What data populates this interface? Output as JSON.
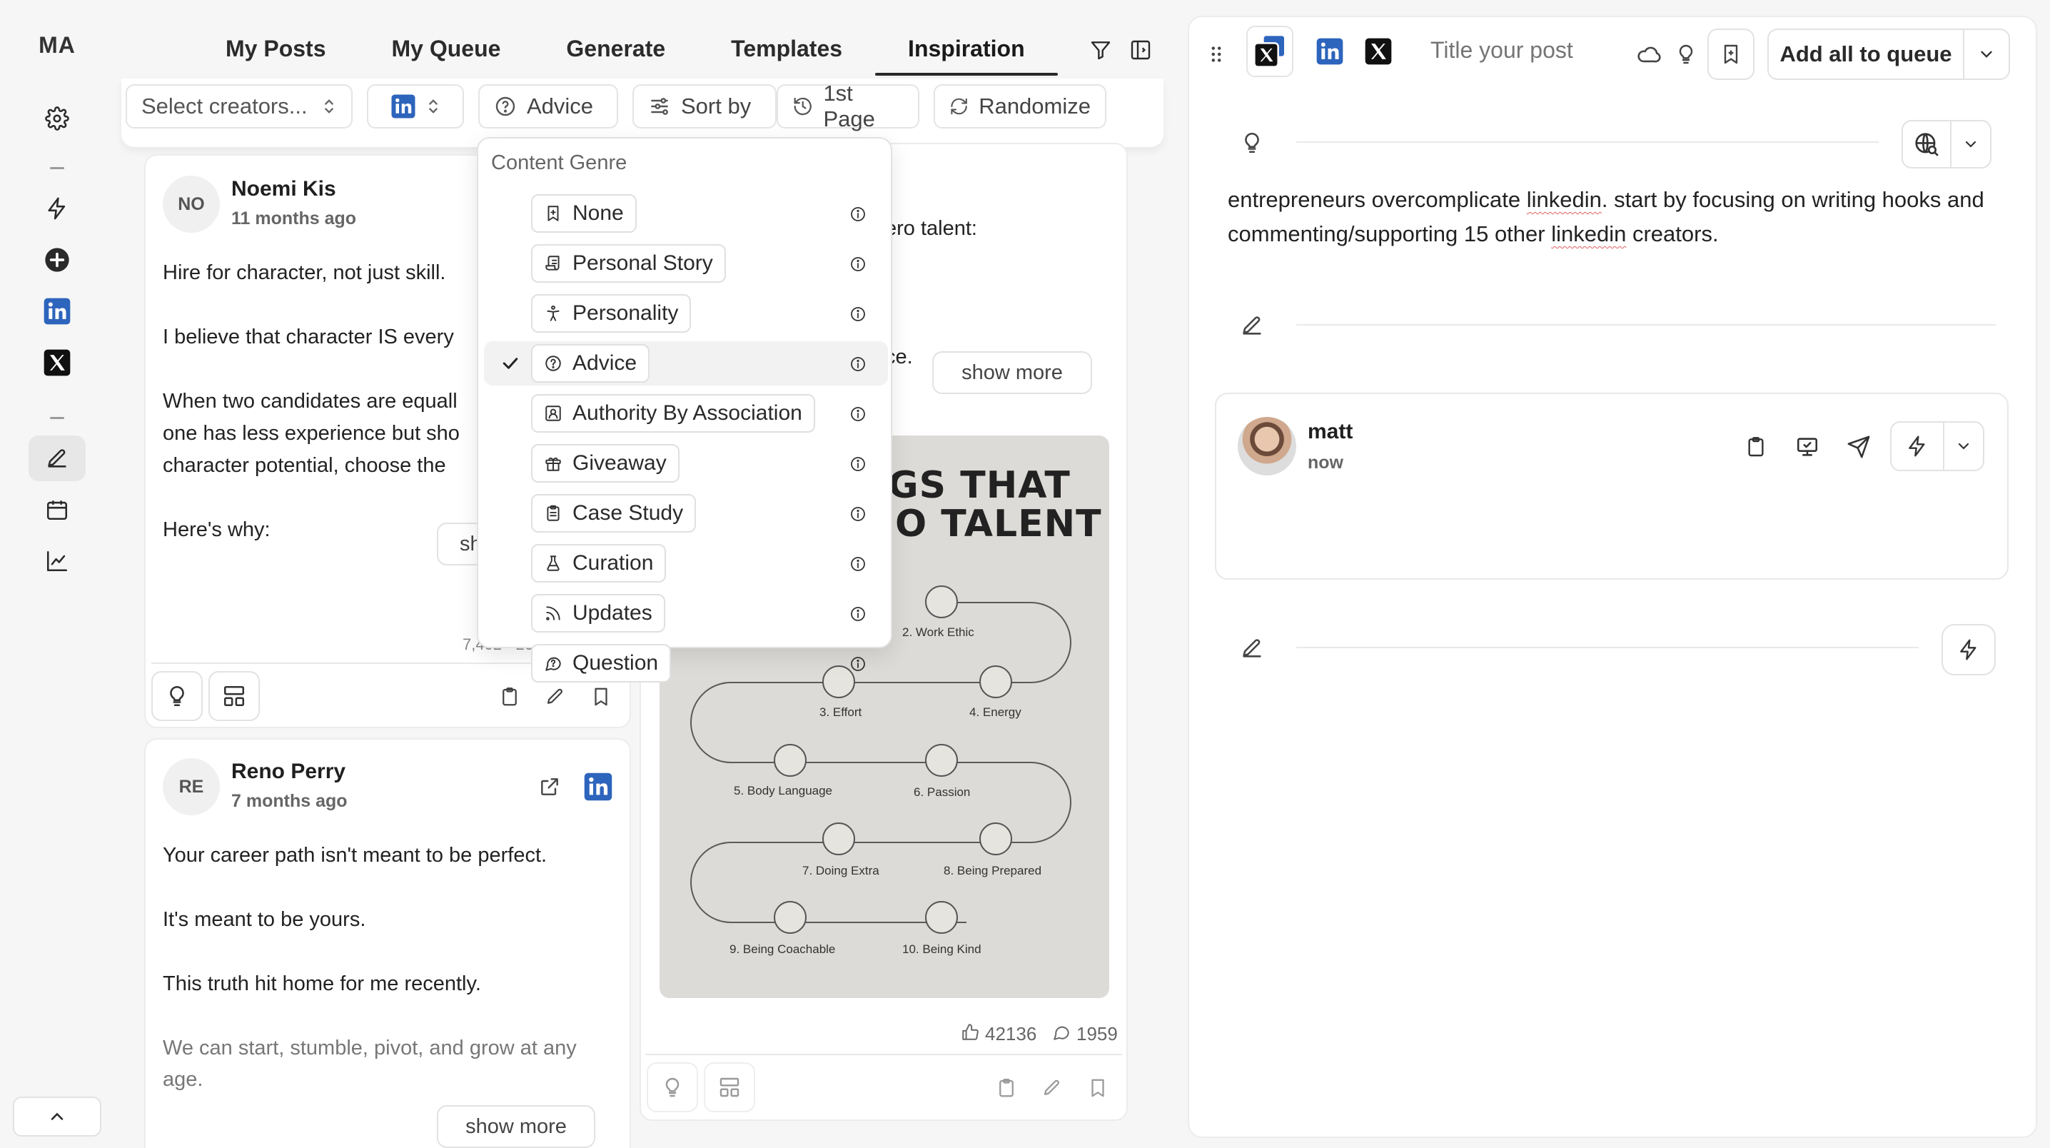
{
  "rail": {
    "avatar_initials": "MA"
  },
  "tabs": [
    {
      "label": "My Posts",
      "active": false
    },
    {
      "label": "My Queue",
      "active": false
    },
    {
      "label": "Generate",
      "active": false
    },
    {
      "label": "Templates",
      "active": false
    },
    {
      "label": "Inspiration",
      "active": true
    }
  ],
  "filters": {
    "creators_placeholder": "Select creators...",
    "genre_value": "Advice",
    "sort_label": "Sort by",
    "page_label": "1st Page",
    "randomize_label": "Randomize"
  },
  "dropdown": {
    "heading": "Content Genre",
    "selected": "Advice",
    "items": [
      {
        "label": "None",
        "icon": "bookmark-icon"
      },
      {
        "label": "Personal Story",
        "icon": "scroll-icon"
      },
      {
        "label": "Personality",
        "icon": "person-icon"
      },
      {
        "label": "Advice",
        "icon": "question-circle-icon"
      },
      {
        "label": "Authority By Association",
        "icon": "contact-icon"
      },
      {
        "label": "Giveaway",
        "icon": "gift-icon"
      },
      {
        "label": "Case Study",
        "icon": "clipboard-icon"
      },
      {
        "label": "Curation",
        "icon": "flask-icon"
      },
      {
        "label": "Updates",
        "icon": "rss-icon"
      },
      {
        "label": "Question",
        "icon": "message-question-icon"
      }
    ]
  },
  "posts": [
    {
      "initials": "NO",
      "author": "Noemi Kis",
      "ago": "11 months ago",
      "lines": [
        "Hire for character, not just skill.",
        "I believe that character IS every",
        "When two candidates are equall",
        "one has less experience but sho",
        "character potential, choose the",
        "Here's why:"
      ],
      "show_more": "sh",
      "stats_partial": "7,402 · 2022"
    },
    {
      "initials": "RE",
      "author": "Reno Perry",
      "ago": "7 months ago",
      "lines": [
        "Your career path isn't meant to be perfect.",
        "It's meant to be yours.",
        "This truth hit home for me recently.",
        "We can start, stumble, pivot, and grow at any",
        "age."
      ],
      "show_more": "show more"
    },
    {
      "partial_line_1": "ero talent:",
      "partial_line_2": "ce.",
      "show_more": "show more",
      "likes": "42136",
      "comments": "1959",
      "infographic": {
        "title_line_1": "GS THAT",
        "title_line_2": "O TALENT",
        "steps": [
          "2. Work Ethic",
          "3. Effort",
          "4. Energy",
          "5. Body Language",
          "6. Passion",
          "7. Doing Extra",
          "8. Being Prepared",
          "9. Being Coachable",
          "10. Being Kind"
        ]
      }
    }
  ],
  "composer": {
    "title_placeholder": "Title your post",
    "add_all_label": "Add all to queue",
    "body_parts": [
      {
        "text": "entrepreneurs overcomplicate ",
        "flag": false
      },
      {
        "text": "linkedin",
        "flag": true
      },
      {
        "text": ". start by focusing on writing hooks and commenting/supporting 15 other ",
        "flag": false
      },
      {
        "text": "linkedin",
        "flag": true
      },
      {
        "text": " creators.",
        "flag": false
      }
    ],
    "preview_name": "matt",
    "preview_time": "now"
  },
  "colors": {
    "linkedin": "#2d64bc",
    "accent_dark": "#1a1a1a"
  }
}
